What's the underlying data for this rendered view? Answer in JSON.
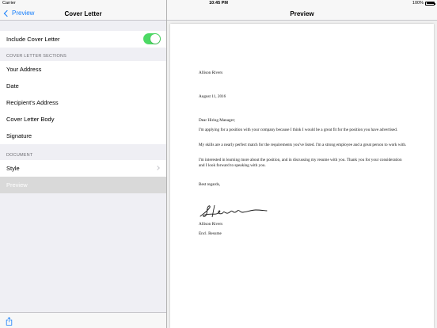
{
  "status_bar": {
    "carrier": "Carrier",
    "time": "10:45 PM",
    "battery": "100%",
    "battery_level": 1.0
  },
  "master": {
    "back_label": "Preview",
    "title": "Cover Letter",
    "include_label": "Include Cover Letter",
    "include_on": true,
    "sections_header": "COVER LETTER SECTIONS",
    "sections": [
      "Your Address",
      "Date",
      "Recipient's Address",
      "Cover Letter Body",
      "Signature"
    ],
    "document_header": "DOCUMENT",
    "style_label": "Style",
    "preview_label": "Preview"
  },
  "detail": {
    "title": "Preview",
    "letter": {
      "name": "Allison Rivers",
      "date": "August 11, 2016",
      "salutation": "Dear Hiring Manager;",
      "p1": "I'm applying for a position with your company because I think I would be a great fit for the position you have advertised.",
      "p2": "My skills are a nearly perfect match for the requirements you've listed.  I'm a strong employee and a great person to work with.",
      "p3": "I'm interested in learning more about the position, and in discussing my resume with you.  Thank you for your consideration and I look forward to speaking with you.",
      "closing": "Best regards,",
      "signed_name": "Allison Rivers",
      "enclosure": "Encl. Resume"
    }
  },
  "icons": {
    "share": "share-icon",
    "back": "chevron-left-icon",
    "disclosure": "chevron-right-icon"
  },
  "colors": {
    "accent": "#157efb",
    "toggle_on": "#4cd964"
  }
}
